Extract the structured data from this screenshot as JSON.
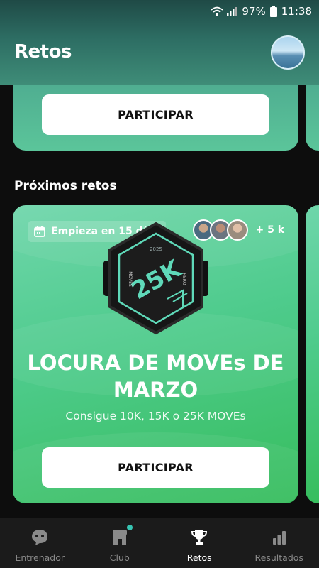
{
  "status_bar": {
    "battery": "97%",
    "time": "11:38"
  },
  "header": {
    "title": "Retos"
  },
  "active_challenge": {
    "button_label": "PARTICIPAR"
  },
  "upcoming": {
    "section_title": "Próximos retos",
    "card": {
      "start_label": "Empieza en 15 días",
      "participant_count": "+ 5 k",
      "badge": {
        "year": "2025",
        "distance": "25K",
        "left_text": "MOVES",
        "right_text": "HERO"
      },
      "title": "LOCURA DE MOVEs DE MARZO",
      "subtitle": "Consigue 10K, 15K o 25K MOVEs",
      "button_label": "PARTICIPAR"
    }
  },
  "nav": {
    "items": [
      {
        "label": "Entrenador",
        "icon": "chat-icon"
      },
      {
        "label": "Club",
        "icon": "store-icon"
      },
      {
        "label": "Retos",
        "icon": "trophy-icon"
      },
      {
        "label": "Resultados",
        "icon": "bar-chart-icon"
      }
    ],
    "active": "Retos"
  },
  "colors": {
    "accent": "#37c4b2",
    "card_green": "#4ecb8c",
    "nav_bg": "#1b1b1b"
  }
}
